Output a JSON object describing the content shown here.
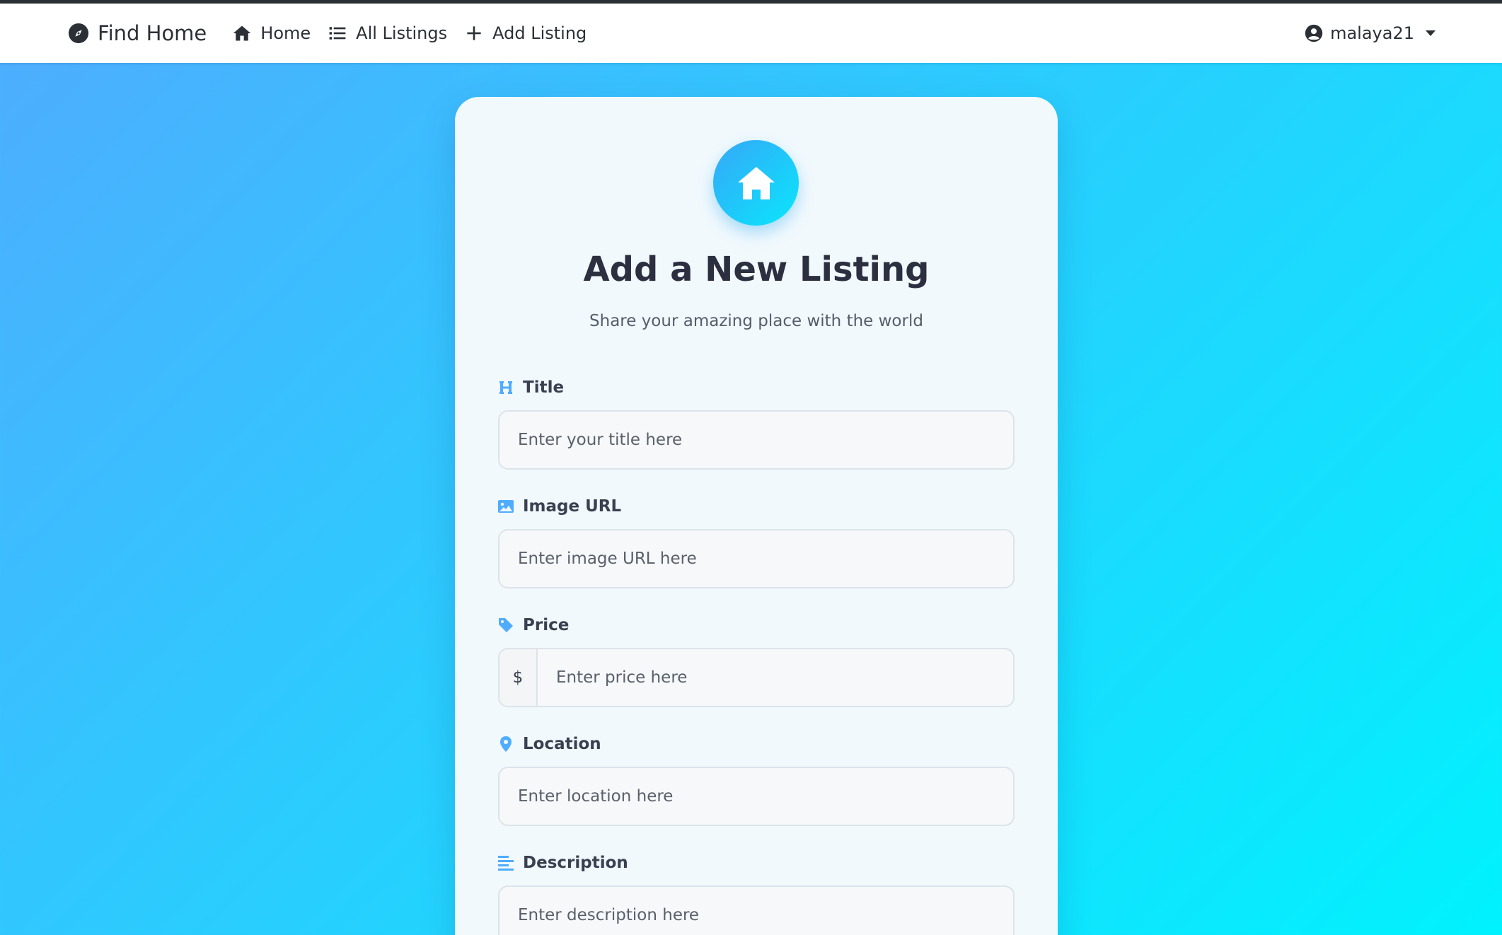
{
  "navbar": {
    "brand": "Find Home",
    "links": [
      {
        "label": "Home",
        "icon": "home-icon"
      },
      {
        "label": "All Listings",
        "icon": "list-icon"
      },
      {
        "label": "Add Listing",
        "icon": "plus-icon"
      }
    ],
    "user": "malaya21"
  },
  "form": {
    "title": "Add a New Listing",
    "subtitle": "Share your amazing place with the world",
    "fields": {
      "title": {
        "label": "Title",
        "placeholder": "Enter your title here",
        "icon": "heading-icon"
      },
      "image": {
        "label": "Image URL",
        "placeholder": "Enter image URL here",
        "icon": "image-icon"
      },
      "price": {
        "label": "Price",
        "placeholder": "Enter price here",
        "prefix": "$",
        "icon": "tag-icon"
      },
      "location": {
        "label": "Location",
        "placeholder": "Enter location here",
        "icon": "location-pin-icon"
      },
      "description": {
        "label": "Description",
        "placeholder": "Enter description here",
        "icon": "align-left-icon"
      }
    }
  },
  "colors": {
    "accent": "#4facfe",
    "gradient_end": "#00f2fe",
    "text_dark": "#2b2f3f"
  }
}
